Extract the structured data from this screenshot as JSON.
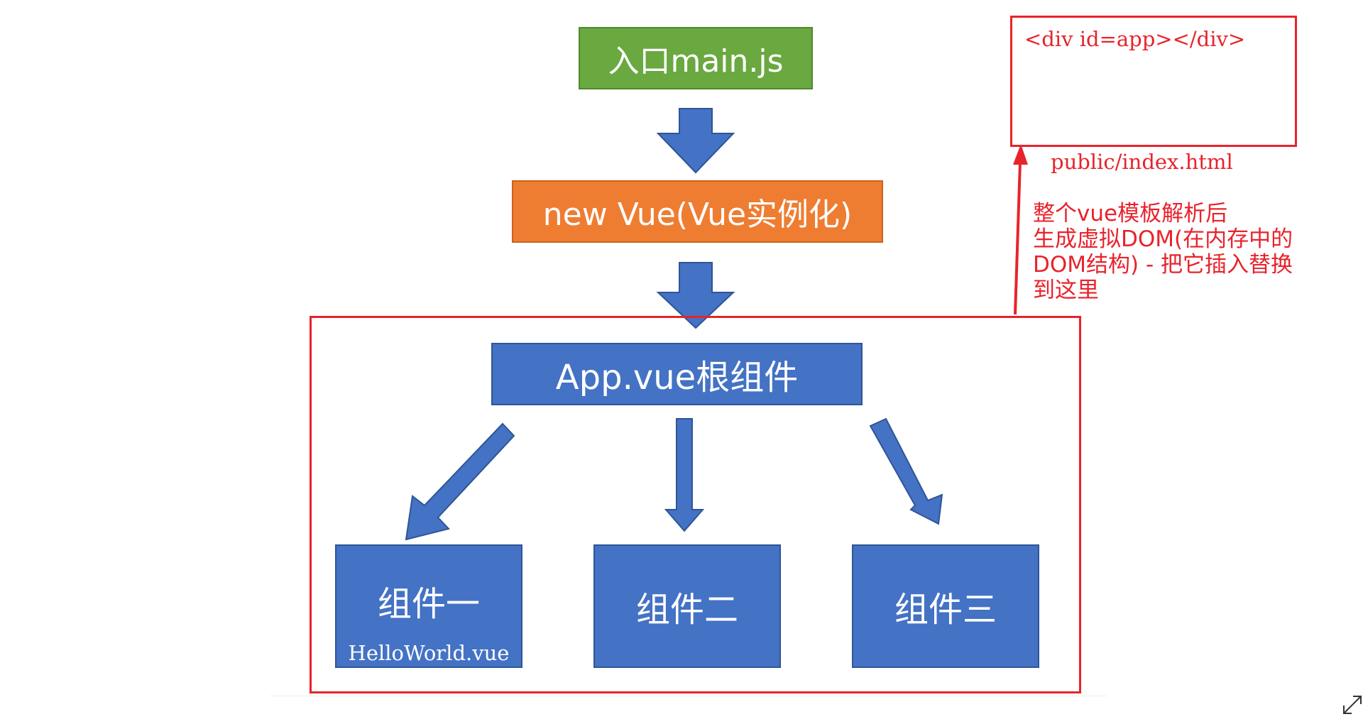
{
  "nodes": {
    "entry": "入口main.js",
    "vue_instance": "new Vue(Vue实例化)",
    "root_component": "App.vue根组件",
    "child1": "组件一",
    "child1_file": "HelloWorld.vue",
    "child2": "组件二",
    "child3": "组件三"
  },
  "html_template": {
    "code": "<div id=app></div>",
    "filename": "public/index.html"
  },
  "annotation": {
    "lines": [
      "整个vue模板解析后",
      "生成虚拟DOM(在内存中的",
      "DOM结构) - 把它插入替换",
      "到这里"
    ]
  },
  "colors": {
    "entry": "#6aa840",
    "vue_instance": "#ee7d32",
    "component": "#4472c4",
    "annotation": "#e8232c"
  },
  "icons": {
    "expand": "expand-icon"
  }
}
